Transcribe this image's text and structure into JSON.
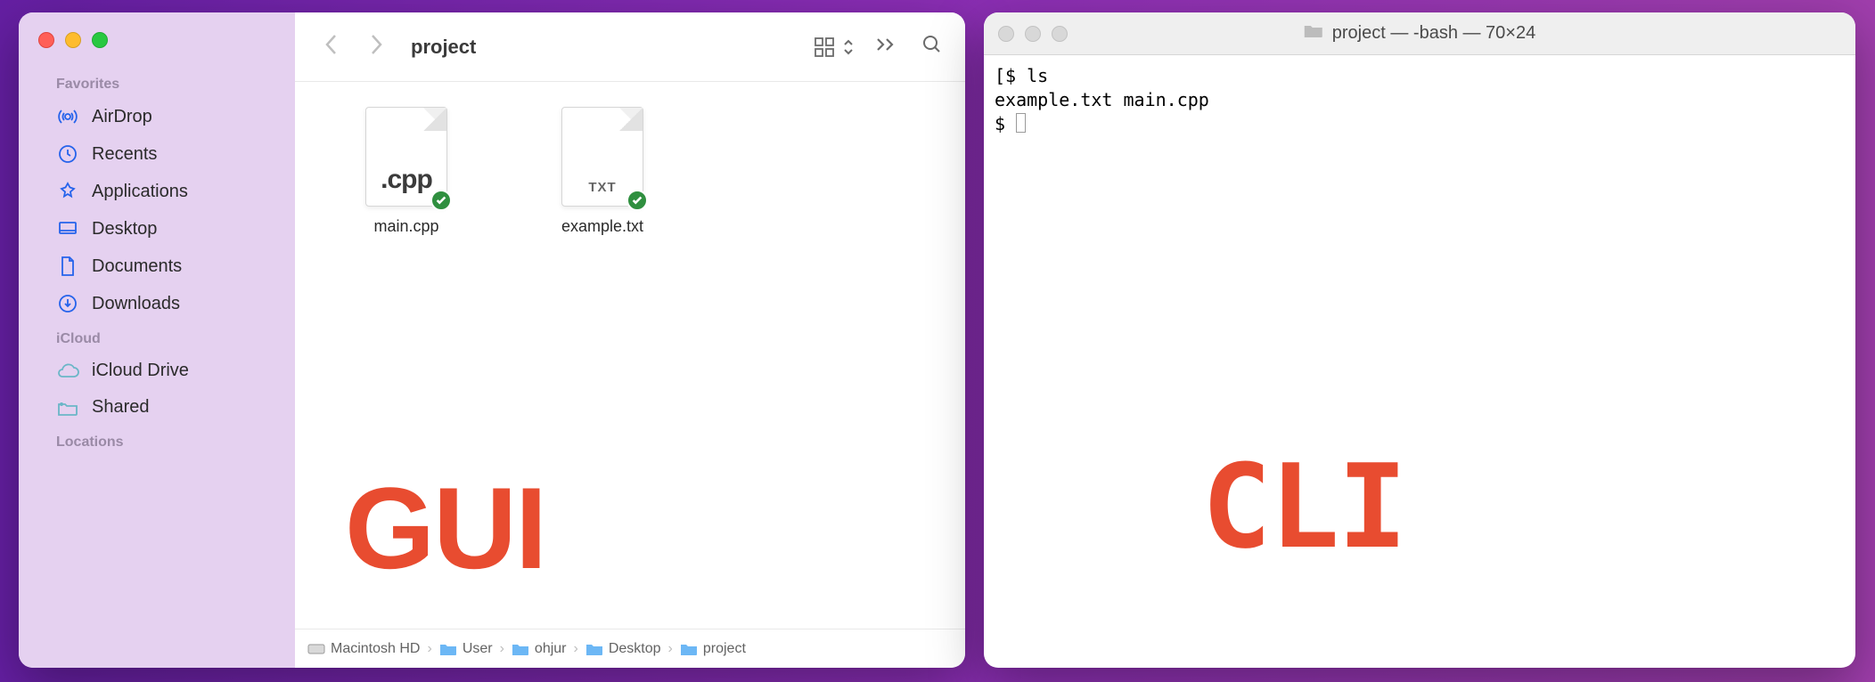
{
  "gui_label": "GUI",
  "cli_label": "CLI",
  "finder": {
    "title": "project",
    "sidebar_sections": [
      {
        "header": "Favorites",
        "items": [
          {
            "id": "airdrop",
            "label": "AirDrop",
            "icon": "airdrop-icon"
          },
          {
            "id": "recents",
            "label": "Recents",
            "icon": "clock-icon"
          },
          {
            "id": "applications",
            "label": "Applications",
            "icon": "apps-icon"
          },
          {
            "id": "desktop",
            "label": "Desktop",
            "icon": "desktop-icon"
          },
          {
            "id": "documents",
            "label": "Documents",
            "icon": "document-icon"
          },
          {
            "id": "downloads",
            "label": "Downloads",
            "icon": "download-icon"
          }
        ]
      },
      {
        "header": "iCloud",
        "items": [
          {
            "id": "icloud-drive",
            "label": "iCloud Drive",
            "icon": "cloud-icon"
          },
          {
            "id": "shared",
            "label": "Shared",
            "icon": "shared-folder-icon"
          }
        ]
      },
      {
        "header": "Locations",
        "items": []
      }
    ],
    "files": [
      {
        "name": "main.cpp",
        "ext_label": ".cpp",
        "kind": "cpp",
        "synced": true
      },
      {
        "name": "example.txt",
        "ext_label": "TXT",
        "kind": "txt",
        "synced": true
      }
    ],
    "path": [
      {
        "label": "Macintosh HD",
        "icon": "disk"
      },
      {
        "label": "User",
        "icon": "folder"
      },
      {
        "label": "ohjur",
        "icon": "folder"
      },
      {
        "label": "Desktop",
        "icon": "folder"
      },
      {
        "label": "project",
        "icon": "folder"
      }
    ]
  },
  "terminal": {
    "title": "project — -bash — 70×24",
    "lines": [
      "[$ ls",
      "example.txt main.cpp",
      "$ "
    ]
  }
}
